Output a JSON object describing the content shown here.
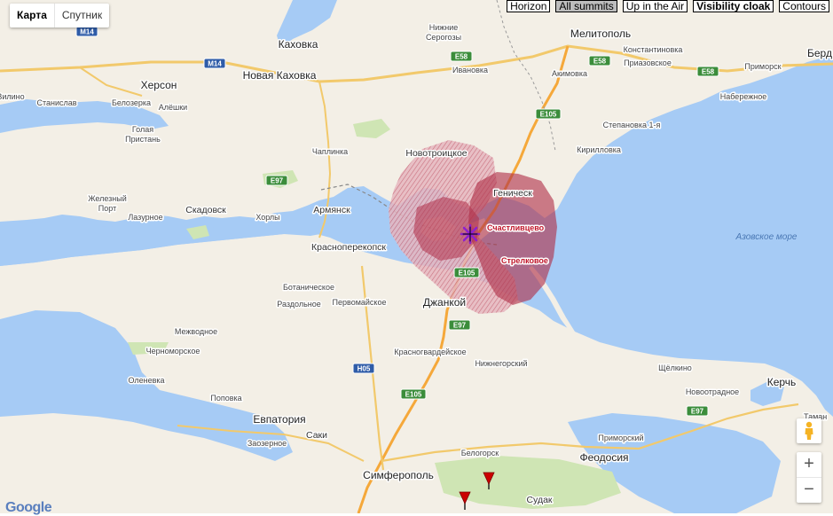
{
  "map_type": {
    "map_label": "Карта",
    "satellite_label": "Спутник"
  },
  "toolbar": {
    "horizon": "Horizon",
    "all_summits": "All summits",
    "up_in_the_air": "Up in the Air",
    "visibility_cloak": "Visibility cloak",
    "contours": "Contours"
  },
  "places": {
    "kherson": "Херсон",
    "kakhovka": "Каховка",
    "nova_kakhovka": "Новая Каховка",
    "melitopol": "Мелитополь",
    "berdyansk": "Берд",
    "nizhnie_serogozy_1": "Нижние",
    "nizhnie_serogozy_2": "Серогозы",
    "konstantinovka": "Константиновка",
    "akimovka": "Акимовка",
    "prizovskoe": "Приазовское",
    "primorsk": "Приморск",
    "nabereznoe": "Набережное",
    "ivanovka": "Ивановка",
    "stanislav": "Станислав",
    "belozerka": "Белозерка",
    "aleshki": "Алёшки",
    "golaya_1": "Голая",
    "golaya_2": "Пристань",
    "stepanovka": "Степановка 1-я",
    "kirillovka": "Кирилловка",
    "chaplinka": "Чаплинка",
    "novotroitskoe": "Новотроицкое",
    "genichesk": "Геническ",
    "schastlivtsevo": "Счастливцево",
    "strelkovoe": "Стрелковое",
    "zheleznyi_1": "Железный",
    "zheleznyi_2": "Порт",
    "lazurnoe": "Лазурное",
    "skadovsk": "Скадовск",
    "khorly": "Хорлы",
    "armyansk": "Армянск",
    "krasnoperekopsk": "Красноперекопск",
    "azov_sea": "Азовское море",
    "botanicheskoe": "Ботаническое",
    "razdolnoe": "Раздольное",
    "pervomayskoe": "Первомайское",
    "dzhankoy": "Джанкой",
    "mezhvodnoe": "Межводное",
    "chernomorskoe": "Черноморское",
    "krasnogvardeyskoe": "Красногвардейское",
    "nizhnegorsky": "Нижнегорский",
    "shchelkino": "Щёлкино",
    "olenevka": "Оленевка",
    "novootradnoe": "Новоотрадное",
    "kerch": "Керчь",
    "popovka": "Поповка",
    "evpatoria": "Евпатория",
    "taman": "Таман",
    "primorsky": "Приморский",
    "saki": "Саки",
    "zaozernoe": "Заозерное",
    "feodosia": "Феодосия",
    "belogorsk": "Белогорск",
    "simferopol": "Симферополь",
    "sudak": "Судак",
    "vilino": "Вилино"
  },
  "roads": {
    "m14_a": "M14",
    "m14_b": "M14",
    "e58_a": "E58",
    "e58_b": "E58",
    "e58_c": "E58",
    "e105_a": "E105",
    "e105_b": "E105",
    "e105_c": "E105",
    "e97_a": "E97",
    "e97_b": "E97",
    "e97_c": "E97",
    "h05": "H05"
  },
  "controls": {
    "zoom_in": "+",
    "zoom_out": "−",
    "google": "Google"
  },
  "colors": {
    "water": "#a6cbf5",
    "land": "#f3efe6",
    "cloak": "#b03048",
    "observer": "#8f1fd1",
    "summit_marker": "#cc0000"
  },
  "icons": {
    "observer": "asterisk-icon",
    "summit": "triangle-marker-icon",
    "pegman": "pegman-icon"
  }
}
